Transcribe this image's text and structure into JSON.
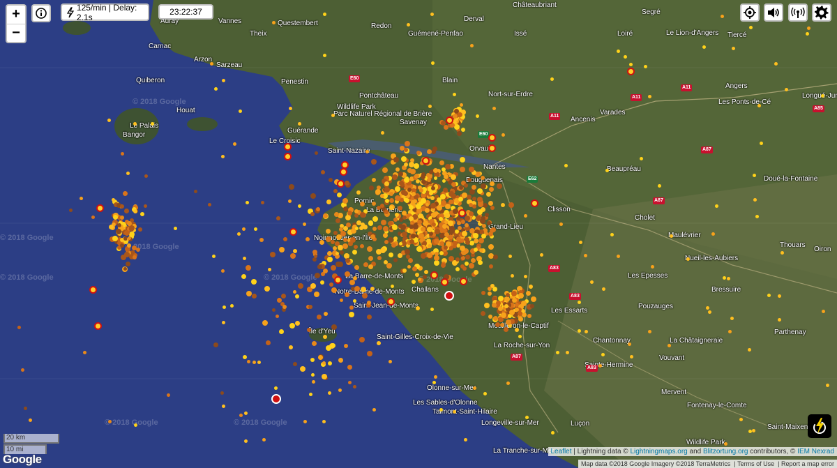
{
  "controls": {
    "zoom_in": "+",
    "zoom_out": "−",
    "info_icon": "info-icon",
    "strike_rate": "125/min | Delay: 2.1s",
    "clock": "23:22:37",
    "locate_icon": "locate-icon",
    "sound_icon": "speaker-icon",
    "signal_icon": "antenna-icon",
    "settings_icon": "gear-icon"
  },
  "scale": {
    "km": "20 km",
    "mi": "10 mi"
  },
  "branding": {
    "google": "Google"
  },
  "attribution": {
    "leaflet": "Leaflet",
    "sep1": " | Lightning data © ",
    "lightningmaps": "Lightningmaps.org",
    "and": " and ",
    "blitzortung": "Blitzortung.org",
    "contributors": " contributors, © ",
    "iem": "IEM Nexrad"
  },
  "footer": {
    "map_data": "Map data ©2018 Google Imagery ©2018 TerraMetrics",
    "terms": "Terms of Use",
    "report": "Report a map error"
  },
  "watermarks": [
    "© 2018 Google",
    "© 2018 Google",
    "© 2018 Google",
    "© 2018 Google",
    "© 2018 Google",
    "© 2018 Google",
    "© 2018 Google",
    "© 2018 Google"
  ],
  "places": [
    "Châteaubriant",
    "Segré",
    "Auray",
    "Vannes",
    "Questembert",
    "Redon",
    "Guémené-Penfao",
    "Issé",
    "Derval",
    "Loiré",
    "Le Lion-d'Angers",
    "Tiercé",
    "Theix",
    "Carnac",
    "Arzon",
    "Sarzeau",
    "Quiberon",
    "Penestin",
    "Blain",
    "Nort-sur-Erdre",
    "Angers",
    "Longué-Jumelles",
    "Pontchâteau",
    "Wildlife Park",
    "Parc Naturel Régional de Brière",
    "Les Ponts-de-Cé",
    "Houat",
    "Le Palais",
    "Bangor",
    "Savenay",
    "Ancenis",
    "Varades",
    "Guérande",
    "Le Croisic",
    "Saint-Nazaire",
    "Orvault",
    "Nantes",
    "Bouguenais",
    "Beaupréau",
    "Doué-la-Fontaine",
    "Pornic",
    "La Bernerie",
    "Clisson",
    "Grand-Lieu",
    "Noirmoutier-en-l'Île",
    "Cholet",
    "Maulévrier",
    "Thouars",
    "Oiron",
    "Nueil-les-Aubiers",
    "La Barre-de-Monts",
    "Notre-Dame-de-Monts",
    "Challans",
    "Les Epesses",
    "Saint-Jean-de-Monts",
    "Les Essarts",
    "Bressuire",
    "Pouzauges",
    "Île d'Yeu",
    "Mouilleron-le-Captif",
    "Saint-Gilles-Croix-de-Vie",
    "La Roche-sur-Yon",
    "Chantonnay",
    "La Châtaigneraie",
    "Parthenay",
    "Vouvant",
    "Sainte-Hermine",
    "Mervent",
    "Olonne-sur-Mer",
    "Les Sables-d'Olonne",
    "Talmont-Saint-Hilaire",
    "Fontenay-le-Comte",
    "Longeville-sur-Mer",
    "Luçon",
    "Saint-Maixent",
    "La Tranche-sur-Mer",
    "Wildlife Park"
  ],
  "roads": [
    "E60",
    "A11",
    "A11",
    "A11",
    "E62",
    "A87",
    "A87",
    "A83",
    "A83",
    "A87",
    "A83",
    "E60",
    "A85"
  ]
}
